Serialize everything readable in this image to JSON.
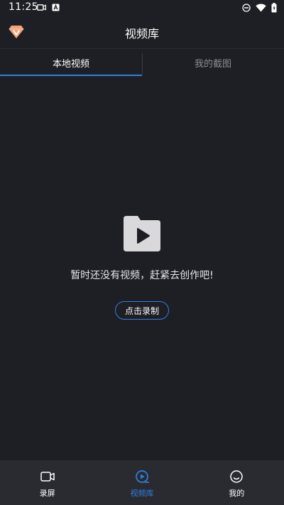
{
  "status_bar": {
    "time": "11:25"
  },
  "header": {
    "title": "视频库"
  },
  "tabs": [
    {
      "label": "本地视频",
      "active": true
    },
    {
      "label": "我的截图",
      "active": false
    }
  ],
  "empty_state": {
    "message": "暂时还没有视频，赶紧去创作吧!",
    "button_label": "点击录制"
  },
  "bottom_nav": [
    {
      "label": "录屏",
      "icon": "video-camera-icon",
      "active": false
    },
    {
      "label": "视频库",
      "icon": "video-library-icon",
      "active": true
    },
    {
      "label": "我的",
      "icon": "profile-icon",
      "active": false
    }
  ],
  "colors": {
    "background": "#1e1f24",
    "accent": "#2f7fe0",
    "nav_background": "#2a2b31",
    "gem": "#f0a47a"
  }
}
